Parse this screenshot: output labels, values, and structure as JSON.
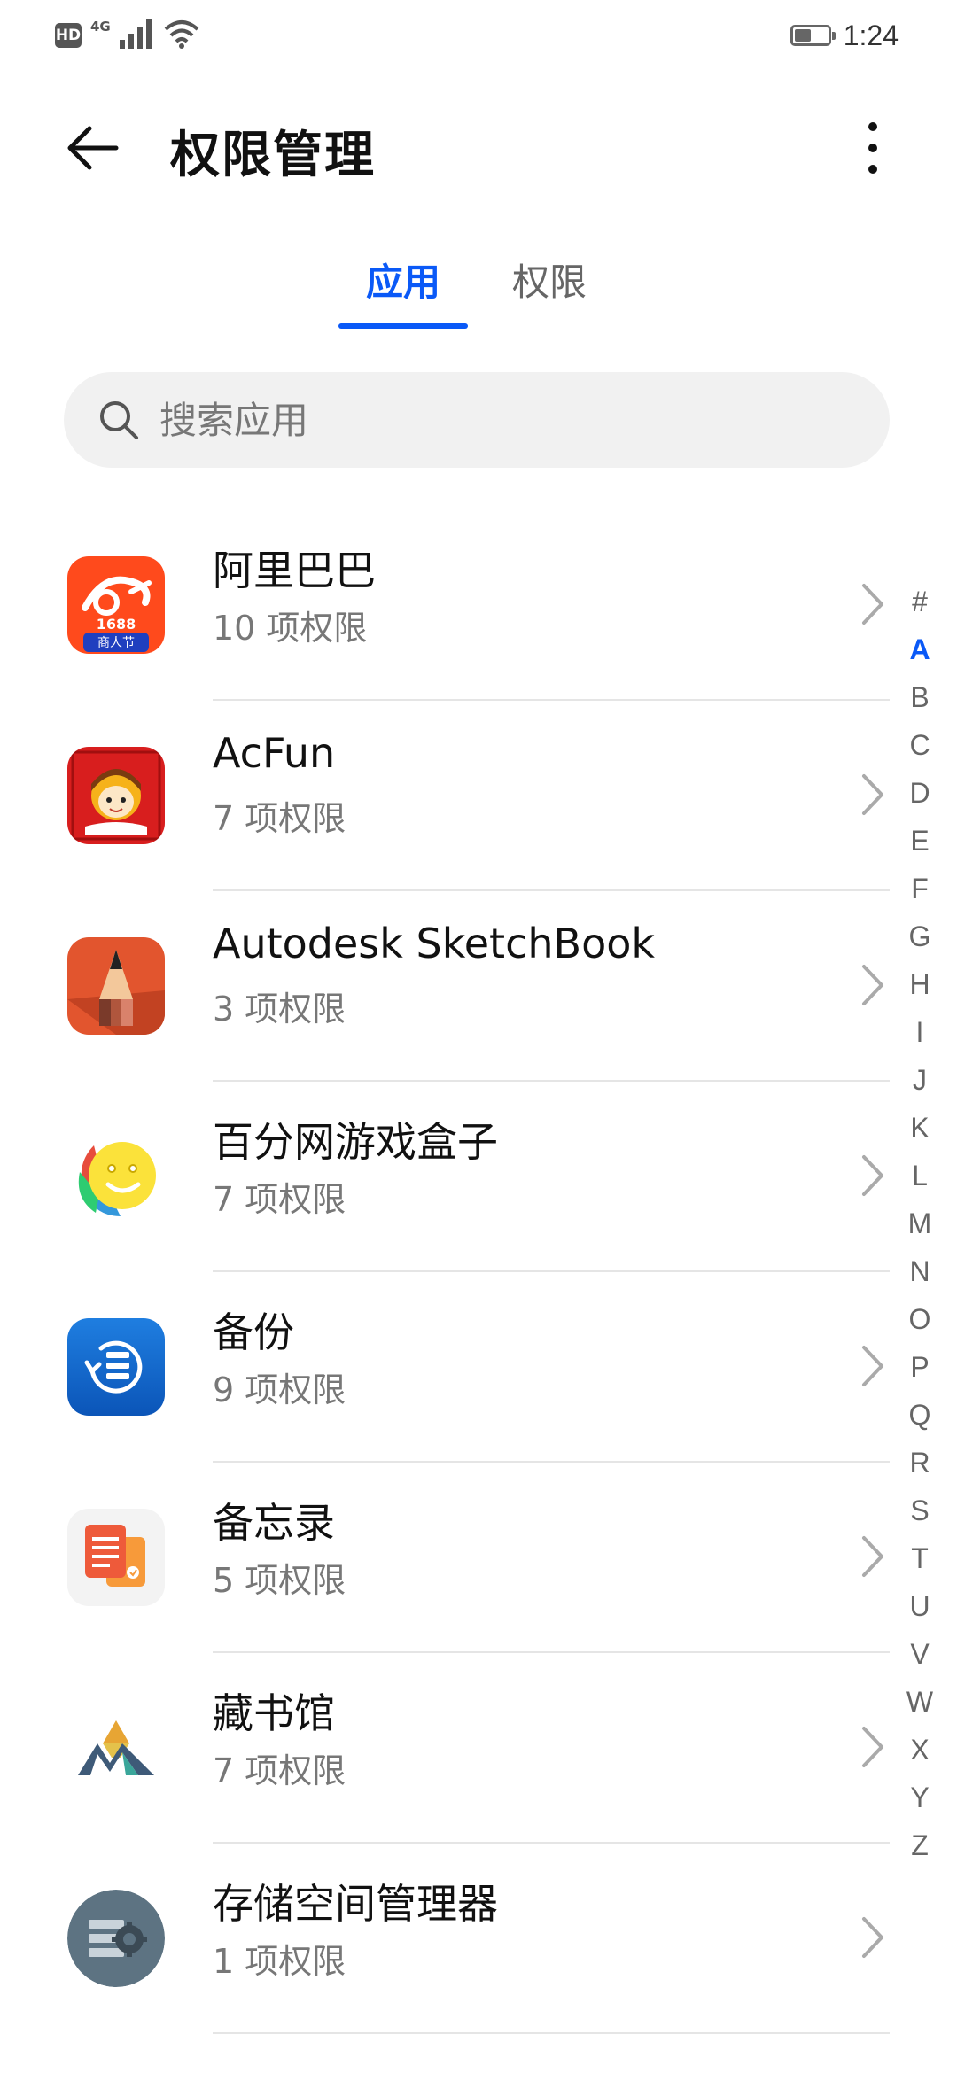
{
  "status_bar": {
    "hd": "HD",
    "network": "4G",
    "time": "1:24",
    "battery_level": 0.55,
    "signal_icon": "signal-icon",
    "wifi_icon": "wifi-icon"
  },
  "header": {
    "title": "权限管理",
    "back_icon": "back-arrow-icon",
    "more_icon": "more-vertical-icon"
  },
  "tabs": {
    "apps": "应用",
    "permissions": "权限",
    "active": "apps"
  },
  "search": {
    "placeholder": "搜索应用",
    "value": ""
  },
  "apps": [
    {
      "name": "阿里巴巴",
      "perms": "10 项权限",
      "icon": "alibaba-icon"
    },
    {
      "name": "AcFun",
      "perms": "7 项权限",
      "icon": "acfun-icon"
    },
    {
      "name": "Autodesk SketchBook",
      "perms": "3 项权限",
      "icon": "sketchbook-icon"
    },
    {
      "name": "百分网游戏盒子",
      "perms": "7 项权限",
      "icon": "game-box-icon"
    },
    {
      "name": "备份",
      "perms": "9 项权限",
      "icon": "backup-icon"
    },
    {
      "name": "备忘录",
      "perms": "5 项权限",
      "icon": "notes-icon"
    },
    {
      "name": "藏书馆",
      "perms": "7 项权限",
      "icon": "library-icon"
    },
    {
      "name": "存储空间管理器",
      "perms": "1 项权限",
      "icon": "storage-manager-icon"
    }
  ],
  "alpha_index": {
    "letters": [
      "#",
      "A",
      "B",
      "C",
      "D",
      "E",
      "F",
      "G",
      "H",
      "I",
      "J",
      "K",
      "L",
      "M",
      "N",
      "O",
      "P",
      "Q",
      "R",
      "S",
      "T",
      "U",
      "V",
      "W",
      "X",
      "Y",
      "Z"
    ],
    "active": "A"
  },
  "colors": {
    "accent": "#0a59f7",
    "search_bg": "#f1f1f1",
    "secondary_text": "#777777"
  },
  "icon_texts": {
    "alibaba_badge_top": "1688",
    "alibaba_badge_bottom": "商人节"
  }
}
